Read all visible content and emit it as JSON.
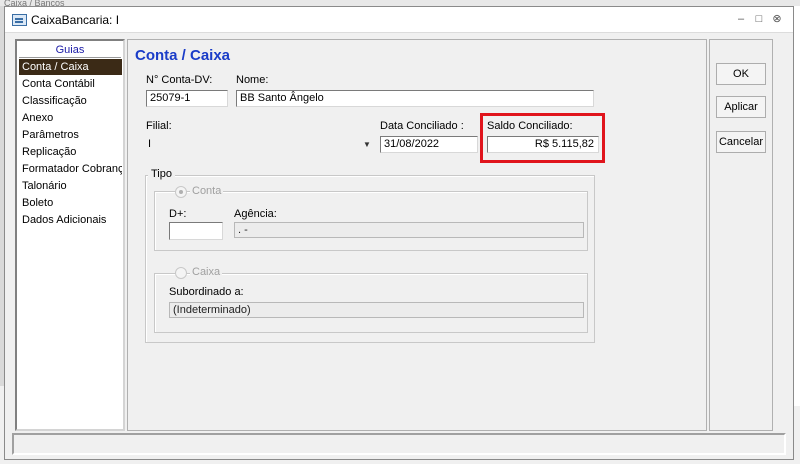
{
  "background": {
    "behind_title": "Caixa / Bancos"
  },
  "window": {
    "title": "CaixaBancaria: I",
    "controls": {
      "minimize": "–",
      "maximize": "□",
      "close": "⊗"
    }
  },
  "guias": {
    "title": "Guias",
    "items": [
      {
        "label": "Conta / Caixa",
        "selected": true
      },
      {
        "label": "Conta Contábil"
      },
      {
        "label": "Classificação"
      },
      {
        "label": "Anexo"
      },
      {
        "label": "Parâmetros"
      },
      {
        "label": "Replicação"
      },
      {
        "label": "Formatador Cobrança"
      },
      {
        "label": "Talonário"
      },
      {
        "label": "Boleto"
      },
      {
        "label": "Dados Adicionais"
      }
    ]
  },
  "form": {
    "heading": "Conta / Caixa",
    "conta_dv": {
      "label": "N° Conta-DV:",
      "value": "25079-1"
    },
    "nome": {
      "label": "Nome:",
      "value": "BB Santo Ângelo"
    },
    "filial": {
      "label": "Filial:",
      "value": "I"
    },
    "data_conciliado": {
      "label": "Data Conciliado :",
      "value": "31/08/2022"
    },
    "saldo_conciliado": {
      "label": "Saldo Conciliado:",
      "value": "R$ 5.115,82"
    },
    "tipo": {
      "label": "Tipo",
      "conta": {
        "label": "Conta",
        "checked": true,
        "d_plus": {
          "label": "D+:",
          "value": ""
        },
        "agencia": {
          "label": "Agência:",
          "value": ". -"
        }
      },
      "caixa": {
        "label": "Caixa",
        "checked": false,
        "subordinado": {
          "label": "Subordinado a:",
          "value": "(Indeterminado)"
        }
      }
    }
  },
  "buttons": {
    "ok": "OK",
    "aplicar": "Aplicar",
    "cancelar": "Cancelar"
  },
  "colors": {
    "highlight": "#e0141c",
    "heading": "#1a3cc8",
    "selection": "#3b2a16"
  }
}
